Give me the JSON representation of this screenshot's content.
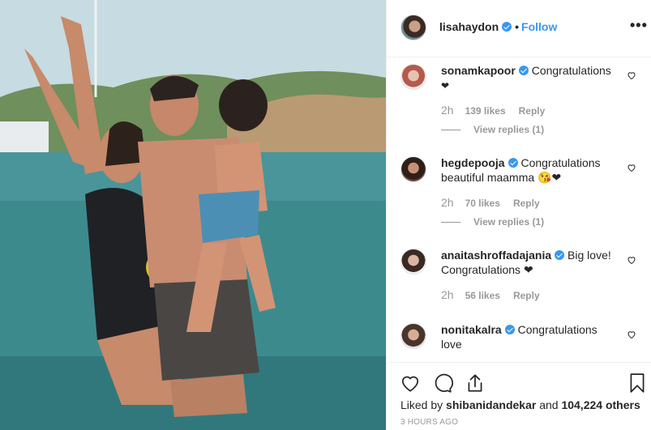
{
  "post": {
    "username": "lisahaydon",
    "dot": "•",
    "follow_label": "Follow",
    "more_label": "•••",
    "liked_prefix": "Liked by ",
    "liked_user": "shibanidandekar",
    "liked_and": " and ",
    "liked_count": "104,224 others",
    "time_ago": "3 HOURS AGO"
  },
  "comments": [
    {
      "username": "sonamkapoor",
      "text": "Congratulations",
      "emoji": "❤",
      "time": "2h",
      "likes": "139 likes",
      "reply": "Reply",
      "view_replies": "View replies (1)"
    },
    {
      "username": "hegdepooja",
      "text": "Congratulations beautiful maamma",
      "emoji": "😘❤",
      "time": "2h",
      "likes": "70 likes",
      "reply": "Reply",
      "view_replies": "View replies (1)"
    },
    {
      "username": "anaitashroffadajania",
      "text": "Big love! Congratulations",
      "emoji": "❤",
      "time": "2h",
      "likes": "56 likes",
      "reply": "Reply"
    },
    {
      "username": "nonitakalra",
      "text": "Congratulations love"
    }
  ],
  "icons": {
    "like": "heart-outline-icon",
    "comment": "comment-bubble-icon",
    "share": "share-upload-icon",
    "save": "bookmark-icon",
    "verified": "verified-badge-icon"
  },
  "colors": {
    "link": "#3897f0",
    "text": "#262626",
    "muted": "#999999",
    "border": "#efefef"
  }
}
